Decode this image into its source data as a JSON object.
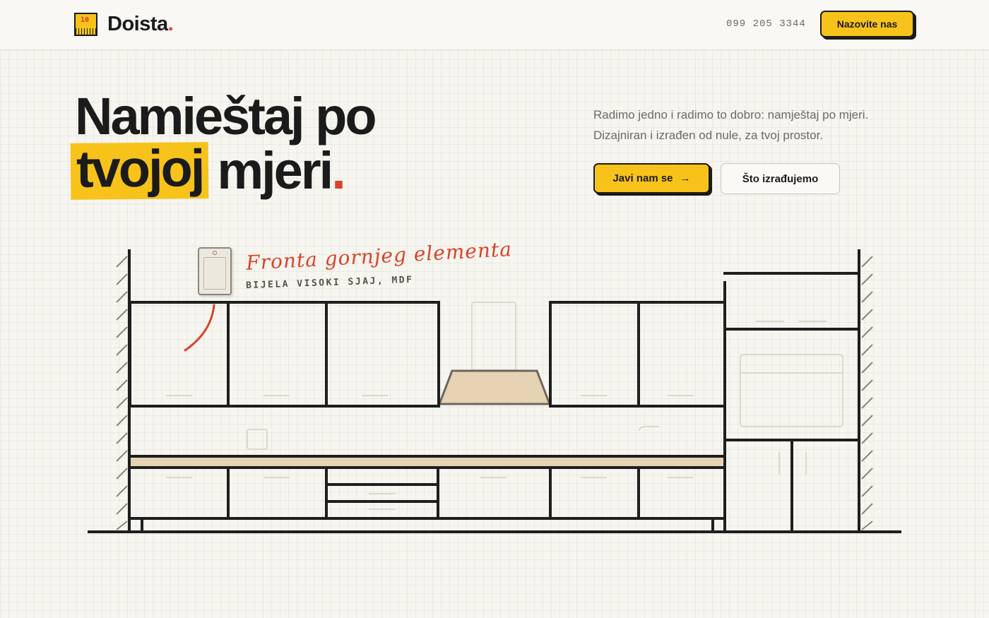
{
  "brand": {
    "name": "Doista",
    "dot": ".",
    "mark_number": "10"
  },
  "header": {
    "phone": "099 205 3344",
    "call_button": "Nazovite nas"
  },
  "hero": {
    "title_line1": "Namieštaj po",
    "title_highlight": "tvojoj",
    "title_rest": "mjeri",
    "title_dot": ".",
    "tagline": "Radimo jedno i radimo to dobro: namještaj po mjeri. Dizajniran i izrađen od nule, za tvoj prostor.",
    "primary_button": "Javi nam se",
    "primary_arrow": "→",
    "secondary_button": "Što izrađujemo"
  },
  "annotation": {
    "title": "Fronta gornjeg elementa",
    "subtitle": "BIJELA VISOKI SJAJ, MDF"
  },
  "colors": {
    "accent": "#f7c31a",
    "red": "#d9432b",
    "ink": "#1b1b1b",
    "wood": "#e6d3b3"
  }
}
